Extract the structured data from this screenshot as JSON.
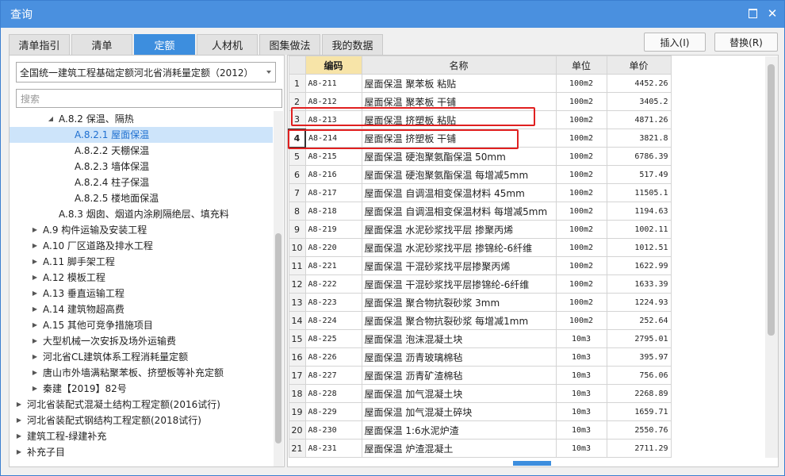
{
  "window": {
    "title": "查询",
    "maximize_icon": "maximize-icon",
    "close_glyph": "✕"
  },
  "tabs": [
    "清单指引",
    "清单",
    "定额",
    "人材机",
    "图集做法",
    "我的数据"
  ],
  "active_tab": 2,
  "buttons": {
    "insert": "插入(I)",
    "replace": "替换(R)"
  },
  "left": {
    "combo_value": "全国统一建筑工程基础定额河北省消耗量定额（2012）",
    "search_placeholder": "搜索",
    "tree": [
      {
        "label": "A.8.2 保温、隔热",
        "level": 3,
        "expanded": true
      },
      {
        "label": "A.8.2.1 屋面保温",
        "level": 4,
        "selected": true
      },
      {
        "label": "A.8.2.2 天棚保温",
        "level": 4
      },
      {
        "label": "A.8.2.3 墙体保温",
        "level": 4
      },
      {
        "label": "A.8.2.4 柱子保温",
        "level": 4
      },
      {
        "label": "A.8.2.5 楼地面保温",
        "level": 4
      },
      {
        "label": "A.8.3 烟囱、烟道内涂刷隔绝层、填充料",
        "level": 3
      },
      {
        "label": "A.9 构件运输及安装工程",
        "level": 2,
        "collapsed": true
      },
      {
        "label": "A.10 厂区道路及排水工程",
        "level": 2,
        "collapsed": true
      },
      {
        "label": "A.11 脚手架工程",
        "level": 2,
        "collapsed": true
      },
      {
        "label": "A.12 模板工程",
        "level": 2,
        "collapsed": true
      },
      {
        "label": "A.13 垂直运输工程",
        "level": 2,
        "collapsed": true
      },
      {
        "label": "A.14 建筑物超高费",
        "level": 2,
        "collapsed": true
      },
      {
        "label": "A.15 其他可竞争措施项目",
        "level": 2,
        "collapsed": true
      },
      {
        "label": "大型机械一次安拆及场外运输费",
        "level": 2,
        "collapsed": true
      },
      {
        "label": "河北省CL建筑体系工程消耗量定额",
        "level": 2,
        "collapsed": true
      },
      {
        "label": "唐山市外墙满粘聚苯板、挤塑板等补充定额",
        "level": 2,
        "collapsed": true
      },
      {
        "label": "秦建【2019】82号",
        "level": 2,
        "collapsed": true
      },
      {
        "label": "河北省装配式混凝土结构工程定额(2016试行)",
        "level": 1,
        "collapsed": true
      },
      {
        "label": "河北省装配式钢结构工程定额(2018试行)",
        "level": 1,
        "collapsed": true
      },
      {
        "label": "建筑工程-绿建补充",
        "level": 1,
        "collapsed": true
      },
      {
        "label": "补充子目",
        "level": 1,
        "collapsed": true
      }
    ]
  },
  "table": {
    "headers": {
      "code": "编码",
      "name": "名称",
      "unit": "单位",
      "price": "单价"
    },
    "current_row": 4,
    "rows": [
      {
        "n": "1",
        "code": "A8-211",
        "name": "屋面保温 聚苯板 粘贴",
        "unit": "100m2",
        "price": "4452.26"
      },
      {
        "n": "2",
        "code": "A8-212",
        "name": "屋面保温 聚苯板 干铺",
        "unit": "100m2",
        "price": "3405.2"
      },
      {
        "n": "3",
        "code": "A8-213",
        "name": "屋面保温 挤塑板 粘贴",
        "unit": "100m2",
        "price": "4871.26"
      },
      {
        "n": "4",
        "code": "A8-214",
        "name": "屋面保温 挤塑板 干铺",
        "unit": "100m2",
        "price": "3821.8"
      },
      {
        "n": "5",
        "code": "A8-215",
        "name": "屋面保温 硬泡聚氨酯保温 50mm",
        "unit": "100m2",
        "price": "6786.39"
      },
      {
        "n": "6",
        "code": "A8-216",
        "name": "屋面保温 硬泡聚氨酯保温 每增减5mm",
        "unit": "100m2",
        "price": "517.49"
      },
      {
        "n": "7",
        "code": "A8-217",
        "name": "屋面保温 自调温相变保温材料 45mm",
        "unit": "100m2",
        "price": "11505.1"
      },
      {
        "n": "8",
        "code": "A8-218",
        "name": "屋面保温 自调温相变保温材料 每增减5mm",
        "unit": "100m2",
        "price": "1194.63"
      },
      {
        "n": "9",
        "code": "A8-219",
        "name": "屋面保温 水泥砂浆找平层 掺聚丙烯",
        "unit": "100m2",
        "price": "1002.11"
      },
      {
        "n": "10",
        "code": "A8-220",
        "name": "屋面保温 水泥砂浆找平层 掺锦纶-6纤维",
        "unit": "100m2",
        "price": "1012.51"
      },
      {
        "n": "11",
        "code": "A8-221",
        "name": "屋面保温 干混砂浆找平层掺聚丙烯",
        "unit": "100m2",
        "price": "1622.99"
      },
      {
        "n": "12",
        "code": "A8-222",
        "name": "屋面保温 干混砂浆找平层掺锦纶-6纤维",
        "unit": "100m2",
        "price": "1633.39"
      },
      {
        "n": "13",
        "code": "A8-223",
        "name": "屋面保温 聚合物抗裂砂浆 3mm",
        "unit": "100m2",
        "price": "1224.93"
      },
      {
        "n": "14",
        "code": "A8-224",
        "name": "屋面保温 聚合物抗裂砂浆 每增减1mm",
        "unit": "100m2",
        "price": "252.64"
      },
      {
        "n": "15",
        "code": "A8-225",
        "name": "屋面保温 泡沫混凝土块",
        "unit": "10m3",
        "price": "2795.01"
      },
      {
        "n": "16",
        "code": "A8-226",
        "name": "屋面保温 沥青玻璃棉毡",
        "unit": "10m3",
        "price": "395.97"
      },
      {
        "n": "17",
        "code": "A8-227",
        "name": "屋面保温 沥青矿渣棉毡",
        "unit": "10m3",
        "price": "756.06"
      },
      {
        "n": "18",
        "code": "A8-228",
        "name": "屋面保温 加气混凝土块",
        "unit": "10m3",
        "price": "2268.89"
      },
      {
        "n": "19",
        "code": "A8-229",
        "name": "屋面保温 加气混凝土碎块",
        "unit": "10m3",
        "price": "1659.71"
      },
      {
        "n": "20",
        "code": "A8-230",
        "name": "屋面保温 1:6水泥炉渣",
        "unit": "10m3",
        "price": "2550.76"
      },
      {
        "n": "21",
        "code": "A8-231",
        "name": "屋面保温 炉渣混凝土",
        "unit": "10m3",
        "price": "2711.29"
      }
    ]
  },
  "colors": {
    "accent": "#3d8ede",
    "highlight_header": "#f7e4a8",
    "annotation": "#e02020",
    "selected_tree": "#cde4fa"
  }
}
